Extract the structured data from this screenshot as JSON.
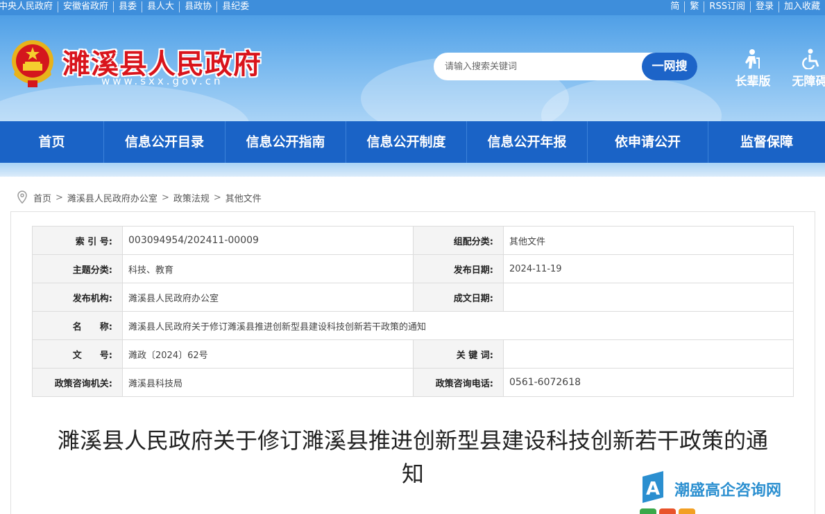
{
  "topbar": {
    "left_links": [
      "中央人民政府",
      "安徽省政府",
      "县委",
      "县人大",
      "县政协",
      "县纪委"
    ],
    "right_links": [
      "简",
      "繁",
      "RSS订阅",
      "登录",
      "加入收藏"
    ]
  },
  "header": {
    "site_title": "濉溪县人民政府",
    "domain": "www.sxx.gov.cn",
    "search_placeholder": "请输入搜索关键词",
    "search_button": "一网搜",
    "tools": [
      "长辈版",
      "无障碍"
    ]
  },
  "nav": {
    "items": [
      "首页",
      "信息公开目录",
      "信息公开指南",
      "信息公开制度",
      "信息公开年报",
      "依申请公开",
      "监督保障"
    ]
  },
  "breadcrumb": [
    "首页",
    "濉溪县人民政府办公室",
    "政策法规",
    "其他文件"
  ],
  "meta": {
    "index_label": "索 引 号:",
    "index_value": "003094954/202411-00009",
    "category_label": "组配分类:",
    "category_value": "其他文件",
    "topic_label": "主题分类:",
    "topic_value": "科技、教育",
    "date_label": "发布日期:",
    "date_value": "2024-11-19",
    "org_label": "发布机构:",
    "org_value": "濉溪县人民政府办公室",
    "written_label": "成文日期:",
    "written_value": "",
    "name_label": "名　　称:",
    "name_value": "濉溪县人民政府关于修订濉溪县推进创新型县建设科技创新若干政策的通知",
    "docno_label": "文　　号:",
    "docno_value": "濉政〔2024〕62号",
    "keyword_label": "关 键 词:",
    "keyword_value": "",
    "consult_org_label": "政策咨询机关:",
    "consult_org_value": "濉溪县科技局",
    "consult_phone_label": "政策咨询电话:",
    "consult_phone_value": "0561-6072618"
  },
  "document": {
    "title_line1": "濉溪县人民政府关于修订濉溪县推进创新型县建设科技创新若干政策的通",
    "title_line2": "知"
  },
  "watermark": {
    "text": "潮盛高企咨询网"
  },
  "colors": {
    "nav_blue": "#1a63c6",
    "title_red": "#d9141c",
    "topbar_blue": "#3e8edb"
  }
}
